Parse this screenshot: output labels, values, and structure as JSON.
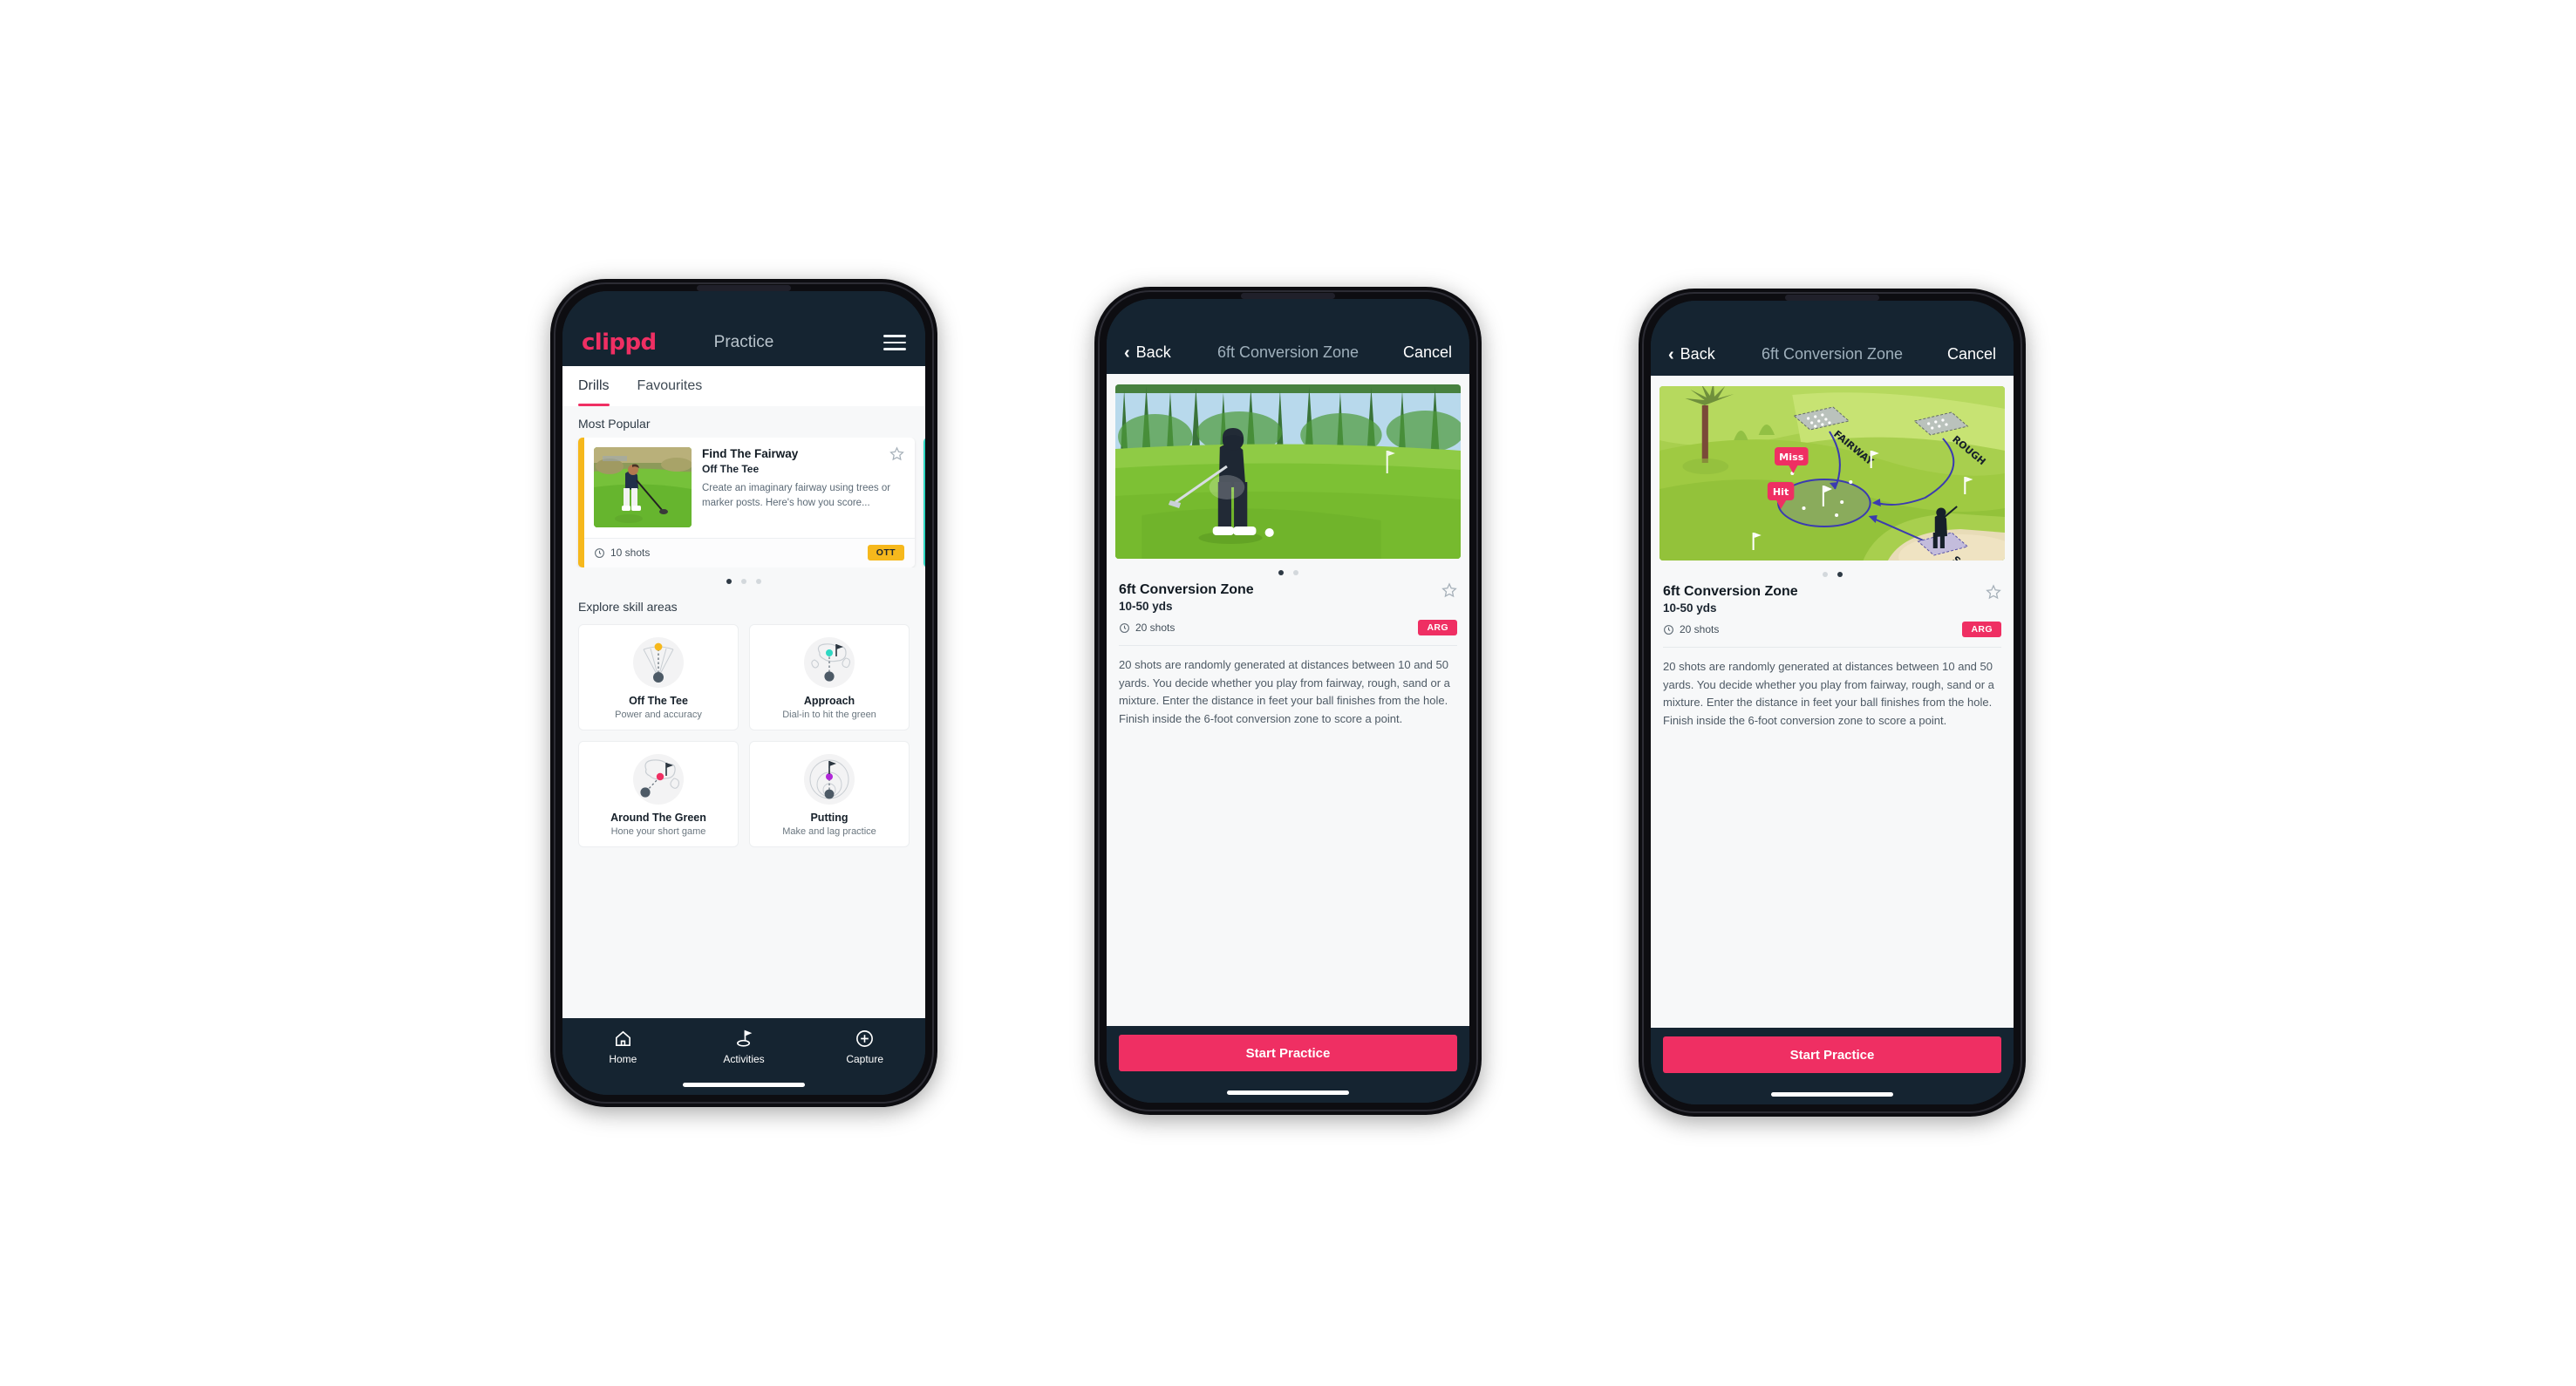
{
  "phone1": {
    "appbar": {
      "logo": "clippd",
      "title": "Practice",
      "menu_icon": "hamburger-icon"
    },
    "tabs": [
      {
        "label": "Drills",
        "active": true
      },
      {
        "label": "Favourites",
        "active": false
      }
    ],
    "sections": {
      "most_popular": "Most Popular",
      "explore": "Explore skill areas"
    },
    "drill_card": {
      "title": "Find The Fairway",
      "subtitle": "Off The Tee",
      "description": "Create an imaginary fairway using trees or marker posts. Here's how you score...",
      "shots": "10 shots",
      "badge": "OTT",
      "badge_color": "#f6b81c",
      "accent_color": "#f6b81c",
      "next_accent_color": "#2fd8c3",
      "star_icon": "star-outline-icon",
      "clock_icon": "clock-icon"
    },
    "carousel_dots": {
      "count": 3,
      "active": 0
    },
    "skills": [
      {
        "name": "Off The Tee",
        "sub": "Power and accuracy",
        "icon": "tee-shot-fan-icon",
        "dot_color": "#f6b81c"
      },
      {
        "name": "Approach",
        "sub": "Dial-in to hit the green",
        "icon": "approach-green-icon",
        "dot_color": "#2fd8c3"
      },
      {
        "name": "Around The Green",
        "sub": "Hone your short game",
        "icon": "chip-green-icon",
        "dot_color": "#ef2f63"
      },
      {
        "name": "Putting",
        "sub": "Make and lag practice",
        "icon": "putting-rings-icon",
        "dot_color": "#b028d8"
      }
    ],
    "tabbar": [
      {
        "label": "Home",
        "icon": "home-icon",
        "active": false
      },
      {
        "label": "Activities",
        "icon": "golf-flag-icon",
        "active": true
      },
      {
        "label": "Capture",
        "icon": "plus-circle-icon",
        "active": false
      }
    ]
  },
  "phone2": {
    "navbar": {
      "back": "Back",
      "title": "6ft Conversion Zone",
      "cancel": "Cancel",
      "back_icon": "chevron-left-icon"
    },
    "hero": {
      "type": "photo",
      "alt": "golfer-pitching-photo"
    },
    "dots": {
      "count": 2,
      "active": 0
    },
    "detail": {
      "title": "6ft Conversion Zone",
      "yards": "10-50 yds",
      "shots": "20 shots",
      "badge": "ARG",
      "badge_color": "#ef2f63",
      "star_icon": "star-outline-icon",
      "clock_icon": "clock-icon",
      "description": "20 shots are randomly generated at distances between 10 and 50 yards. You decide whether you play from fairway, rough, sand or a mixture. Enter the distance in feet your ball finishes from the hole. Finish inside the 6-foot conversion zone to score a point."
    },
    "cta": "Start Practice"
  },
  "phone3": {
    "navbar": {
      "back": "Back",
      "title": "6ft Conversion Zone",
      "cancel": "Cancel",
      "back_icon": "chevron-left-icon"
    },
    "hero": {
      "type": "illustration",
      "alt": "isometric-golf-course-diagram",
      "labels": {
        "fairway": "FAIRWAY",
        "rough": "ROUGH",
        "sand": "SAND",
        "miss": "Miss",
        "hit": "Hit"
      },
      "callout_color": "#ef2f63",
      "arrow_color": "#3b3bb0"
    },
    "dots": {
      "count": 2,
      "active": 1
    },
    "detail": {
      "title": "6ft Conversion Zone",
      "yards": "10-50 yds",
      "shots": "20 shots",
      "badge": "ARG",
      "badge_color": "#ef2f63",
      "star_icon": "star-outline-icon",
      "clock_icon": "clock-icon",
      "description": "20 shots are randomly generated at distances between 10 and 50 yards. You decide whether you play from fairway, rough, sand or a mixture. Enter the distance in feet your ball finishes from the hole. Finish inside the 6-foot conversion zone to score a point."
    },
    "cta": "Start Practice"
  }
}
